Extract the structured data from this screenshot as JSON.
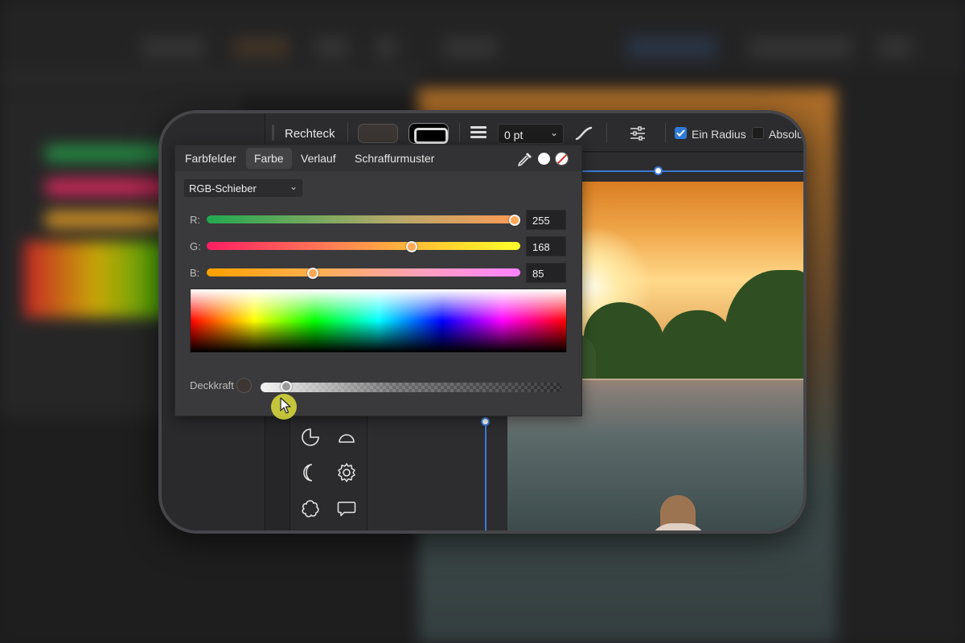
{
  "toolbar": {
    "tool_name": "Rechteck",
    "stroke_width": "0 pt",
    "ein_radius_label": "Ein Radius",
    "ein_radius_checked": true,
    "absolut_label": "Absolu",
    "absolut_checked": false,
    "accent_color": "#2f7ad9"
  },
  "color_panel": {
    "tabs": [
      {
        "label": "Farbfelder",
        "active": false
      },
      {
        "label": "Farbe",
        "active": true
      },
      {
        "label": "Verlauf",
        "active": false
      },
      {
        "label": "Schraffurmuster",
        "active": false
      }
    ],
    "mode": "RGB-Schieber",
    "sliders": [
      {
        "label": "R:",
        "value": "255",
        "fraction": 1.0,
        "gradient": "linear-gradient(90deg,#22a84f 0%,#b5a86a 60%,#ff9a55 100%)",
        "knob_color": "#ffa855"
      },
      {
        "label": "G:",
        "value": "168",
        "fraction": 0.6588,
        "gradient": "linear-gradient(90deg,#ff1e63 0%,#ff7f55 40%,#ffd02e 75%,#ffff2a 100%)",
        "knob_color": "#ffa855"
      },
      {
        "label": "B:",
        "value": "85",
        "fraction": 0.3333,
        "gradient": "linear-gradient(90deg,#ffa000 0%,#ffb050 35%,#ff9ec0 70%,#ff82ff 100%)",
        "knob_color": "#ffa855"
      }
    ],
    "opacity_label": "Deckkraft",
    "opacity_fraction": 0.07,
    "current_color": "#ffa855"
  },
  "icons": {
    "eyedropper": "eyedropper-icon",
    "none_swatch": "no-color-icon",
    "cursor": "mouse-pointer-icon"
  }
}
